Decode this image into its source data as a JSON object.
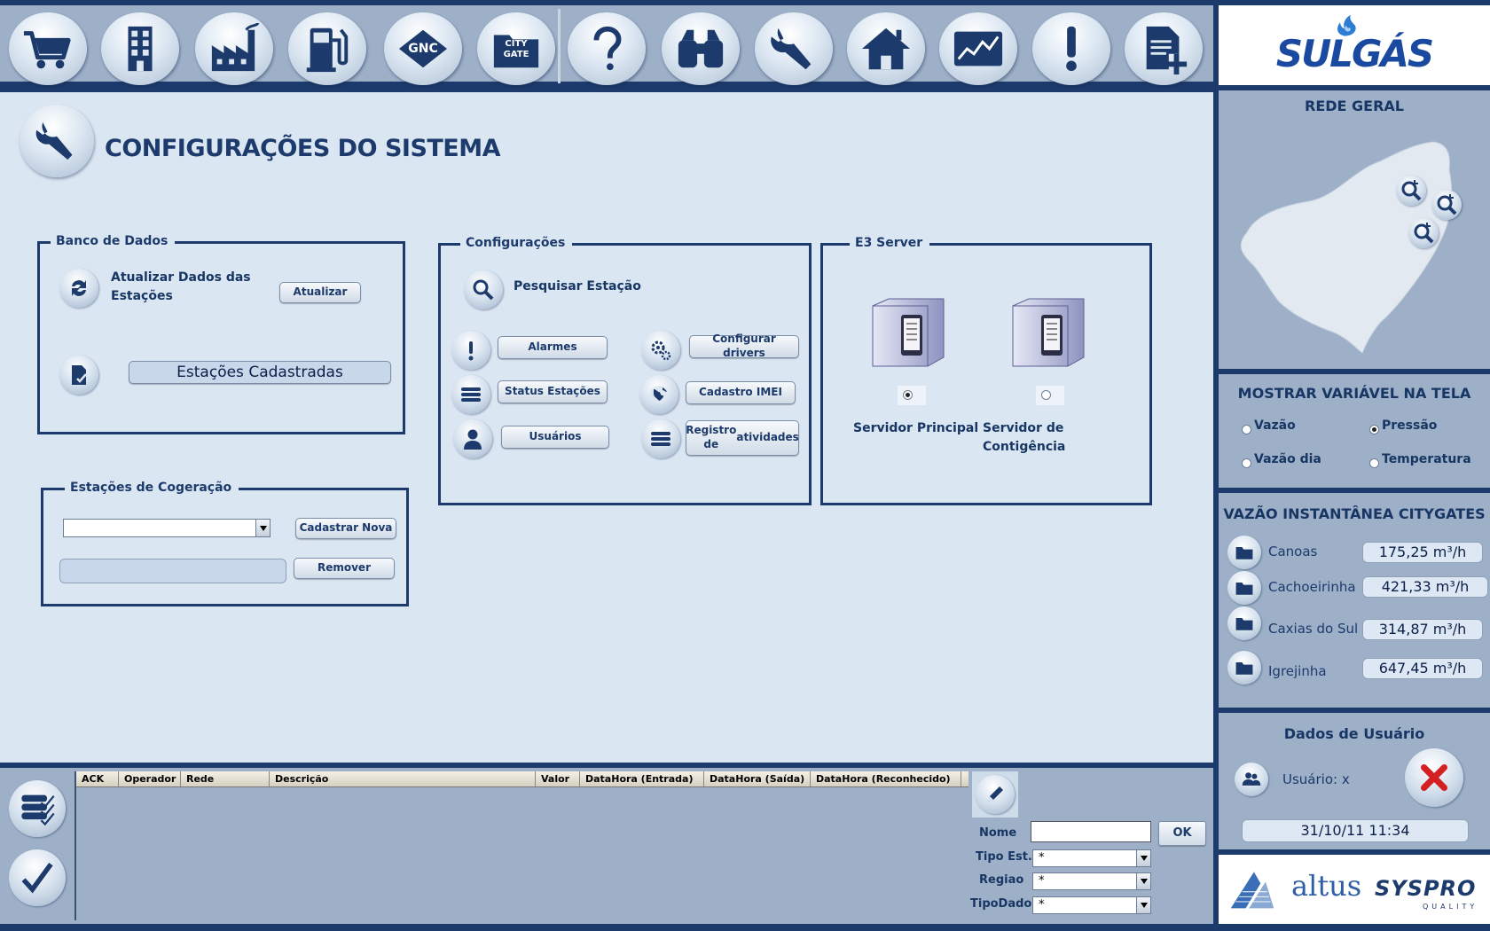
{
  "toolbar": {
    "gnc_label": "GNC",
    "citygate_line1": "CITY",
    "citygate_line2": "GATE"
  },
  "page": {
    "title": "CONFIGURAÇÕES DO SISTEMA"
  },
  "banco_dados": {
    "legend": "Banco de Dados",
    "update_text_line1": "Atualizar Dados das",
    "update_text_line2": "Estações",
    "atualizar_button": "Atualizar",
    "estacoes_cadastradas_button": "Estações Cadastradas"
  },
  "configuracoes": {
    "legend": "Configurações",
    "search_text": "Pesquisar Estação",
    "alarmes_button": "Alarmes",
    "status_button": "Status Estações",
    "usuarios_button": "Usuários",
    "drivers_button": "Configurar drivers",
    "imei_button": "Cadastro IMEI",
    "registro_line1": "Registro de",
    "registro_line2": "atividades"
  },
  "e3server": {
    "legend": "E3 Server",
    "principal_label": "Servidor Principal",
    "contingencia_label": "Servidor de Contigência",
    "principal_selected": true
  },
  "cogeracao": {
    "legend": "Estações de Cogeração",
    "cadastrar_button": "Cadastrar Nova",
    "remover_button": "Remover"
  },
  "alarms": {
    "columns": [
      "ACK",
      "Operador",
      "Rede",
      "Descrição",
      "Valor",
      "DataHora (Entrada)",
      "DataHora (Saída)",
      "DataHora (Reconhecido)"
    ]
  },
  "filters": {
    "nome_label": "Nome",
    "ok_button": "OK",
    "tipo_label": "Tipo Est.",
    "tipo_value": "*",
    "regiao_label": "Regiao",
    "regiao_value": "*",
    "tipodado_label": "TipoDado",
    "tipodado_value": "*"
  },
  "sidebar": {
    "brand": "SULGÁS",
    "rede_geral": "REDE GERAL",
    "mostrar_title": "MOSTRAR VARIÁVEL NA TELA",
    "vars": {
      "vazao": "Vazão",
      "pressao": "Pressão",
      "vazao_dia": "Vazão dia",
      "temperatura": "Temperatura",
      "selected": "Pressão"
    },
    "vazao_title": "VAZÃO INSTANTÂNEA CITYGATES",
    "citygates": [
      {
        "name": "Canoas",
        "value": "175,25 m³/h"
      },
      {
        "name": "Cachoeirinha",
        "value": "421,33 m³/h"
      },
      {
        "name": "Caxias do Sul",
        "value": "314,87 m³/h"
      },
      {
        "name": "Igrejinha",
        "value": "647,45 m³/h"
      }
    ],
    "dados_usuario": "Dados de Usuário",
    "usuario": "Usuário: x",
    "datetime": "31/10/11 11:34",
    "footer_altus": "altus",
    "footer_syspro": "SYSPRO",
    "footer_quality": "QUALITY"
  },
  "colors": {
    "navy": "#1c3a6b",
    "panel_bg": "#dbe6f3",
    "sidebar_bg": "#9db0c8",
    "close_red": "#d42020"
  }
}
